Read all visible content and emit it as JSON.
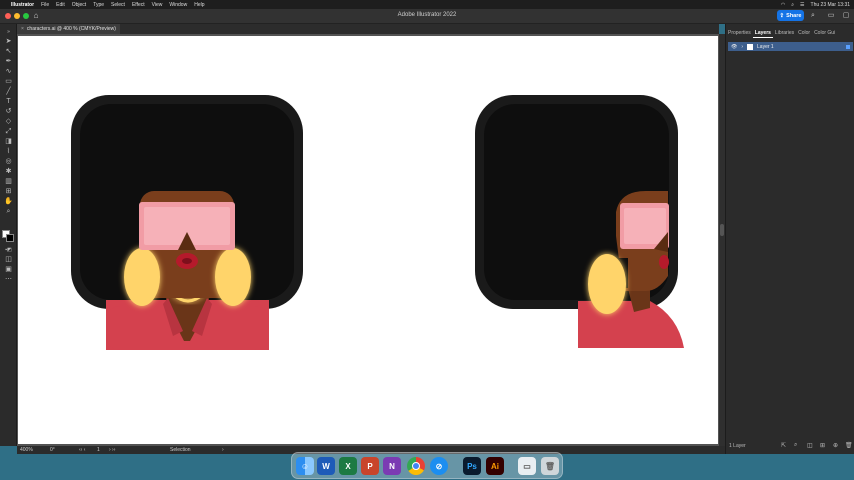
{
  "menubar": {
    "app_name": "Illustrator",
    "items": [
      "File",
      "Edit",
      "Object",
      "Type",
      "Select",
      "Effect",
      "View",
      "Window",
      "Help"
    ],
    "clock": "Thu 23 Mar 13:31"
  },
  "window": {
    "title": "Adobe Illustrator 2022",
    "share_label": "Share"
  },
  "document": {
    "tab_label": "characters.ai @ 400 % (CMYK/Preview)",
    "tab_close": "×"
  },
  "panel": {
    "tabs": [
      "Properties",
      "Layers",
      "Libraries",
      "Color",
      "Color Gui"
    ],
    "active_tab": "Layers",
    "layer_name": "Layer 1",
    "layer_count": "1 Layer"
  },
  "status": {
    "zoom": "400%",
    "rotation": "0°",
    "artboard_index": "1",
    "tool_label": "Selection"
  },
  "colors": {
    "accent": "#1473e6",
    "canvas": "#535353",
    "frame": "#1a1a1a",
    "hair": "#0e0e0e",
    "skin": "#7a3e1c",
    "shirt": "#d4414e",
    "glasses": "#f19ca5",
    "earring": "#ffd46b"
  },
  "dock": {
    "apps": [
      "Finder",
      "Word",
      "Excel",
      "PowerPoint",
      "OneNote",
      "Chrome",
      "Safari",
      "Photoshop",
      "Illustrator",
      "Preview",
      "Trash"
    ]
  }
}
